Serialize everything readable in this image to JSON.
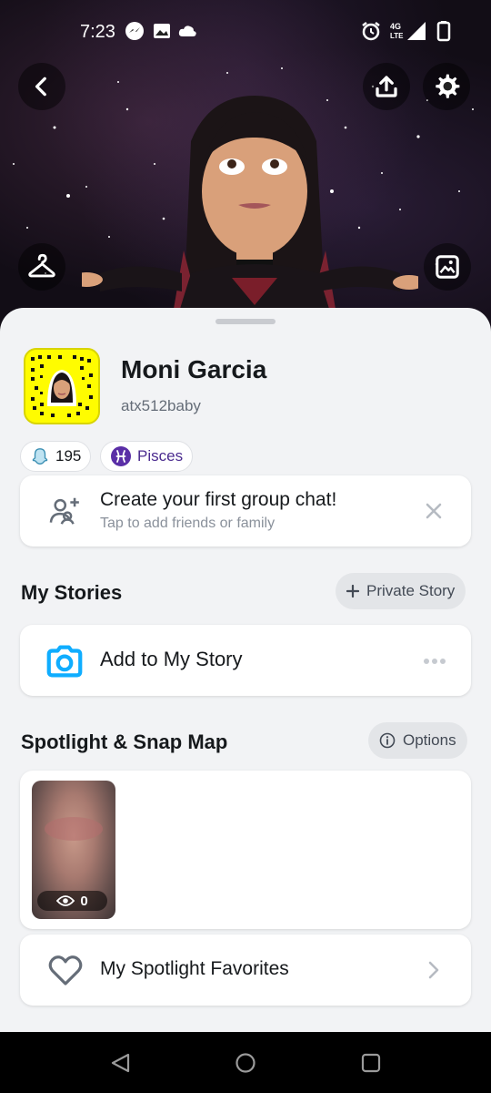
{
  "status_bar": {
    "time": "7:23",
    "network": "4G LTE"
  },
  "profile": {
    "display_name": "Moni Garcia",
    "username": "atx512baby",
    "snap_score": "195",
    "zodiac": "Pisces"
  },
  "group_chat_card": {
    "title": "Create your first group chat!",
    "subtitle": "Tap to add friends or family"
  },
  "my_stories": {
    "title": "My Stories",
    "private_story_label": "Private Story",
    "add_story_label": "Add to My Story"
  },
  "spotlight": {
    "title": "Spotlight & Snap Map",
    "options_label": "Options",
    "view_count": "0",
    "favorites_label": "My Spotlight Favorites"
  },
  "colors": {
    "snapcode_yellow": "#fffc00",
    "accent_blue": "#0fadff",
    "zodiac_purple": "#5a2ea6"
  }
}
